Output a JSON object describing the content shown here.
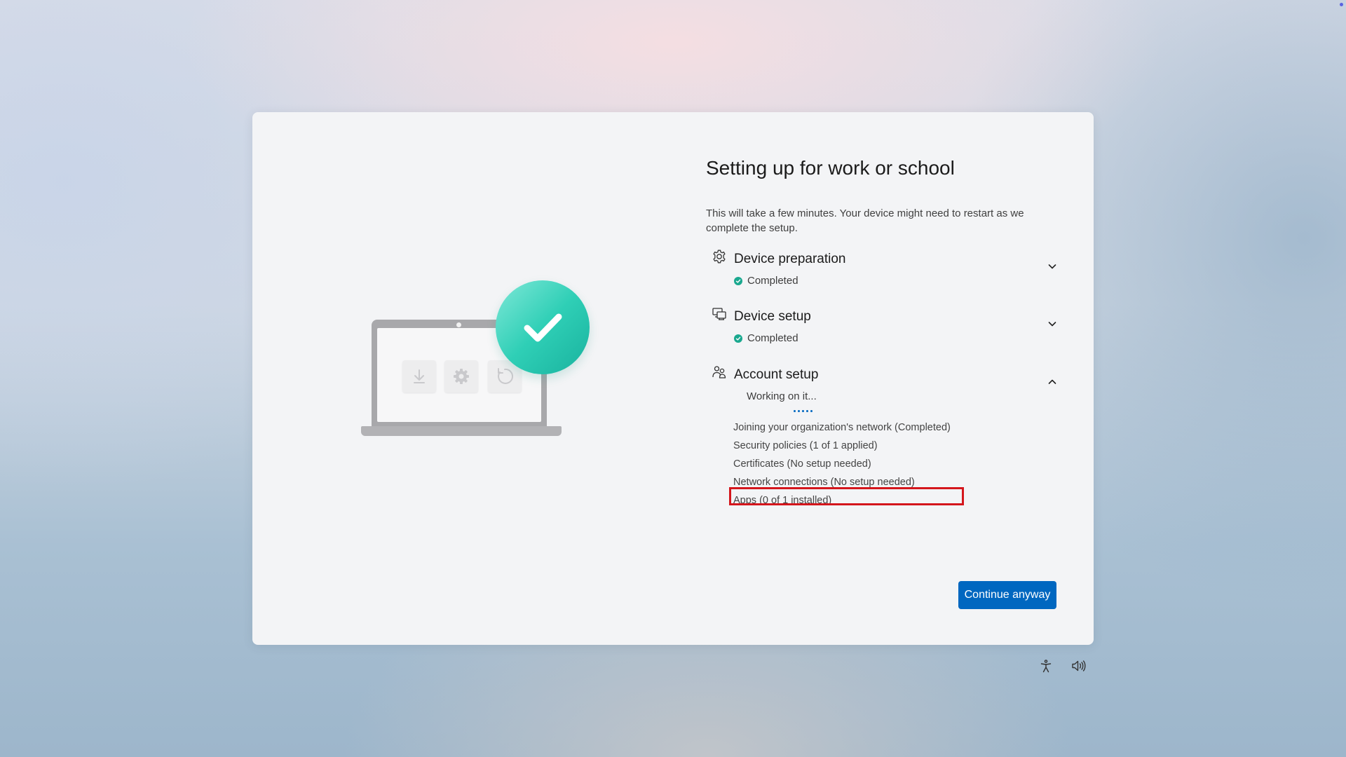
{
  "title": "Setting up for work or school",
  "description": "This will take a few minutes. Your device might need to restart as we complete the setup.",
  "sections": [
    {
      "title": "Device preparation",
      "status": "Completed",
      "icon": "gear-icon",
      "expanded": false
    },
    {
      "title": "Device setup",
      "status": "Completed",
      "icon": "devices-icon",
      "expanded": false
    },
    {
      "title": "Account setup",
      "status": "Working on it...",
      "icon": "people-icon",
      "expanded": true
    }
  ],
  "account_items": [
    "Joining your organization's network (Completed)",
    "Security policies (1 of 1 applied)",
    "Certificates (No setup needed)",
    "Network connections (No setup needed)",
    "Apps (0 of 1 installed)"
  ],
  "continue_label": "Continue anyway",
  "colors": {
    "accent": "#0067c0",
    "success": "#1aa88f",
    "highlight": "#d4161c"
  }
}
